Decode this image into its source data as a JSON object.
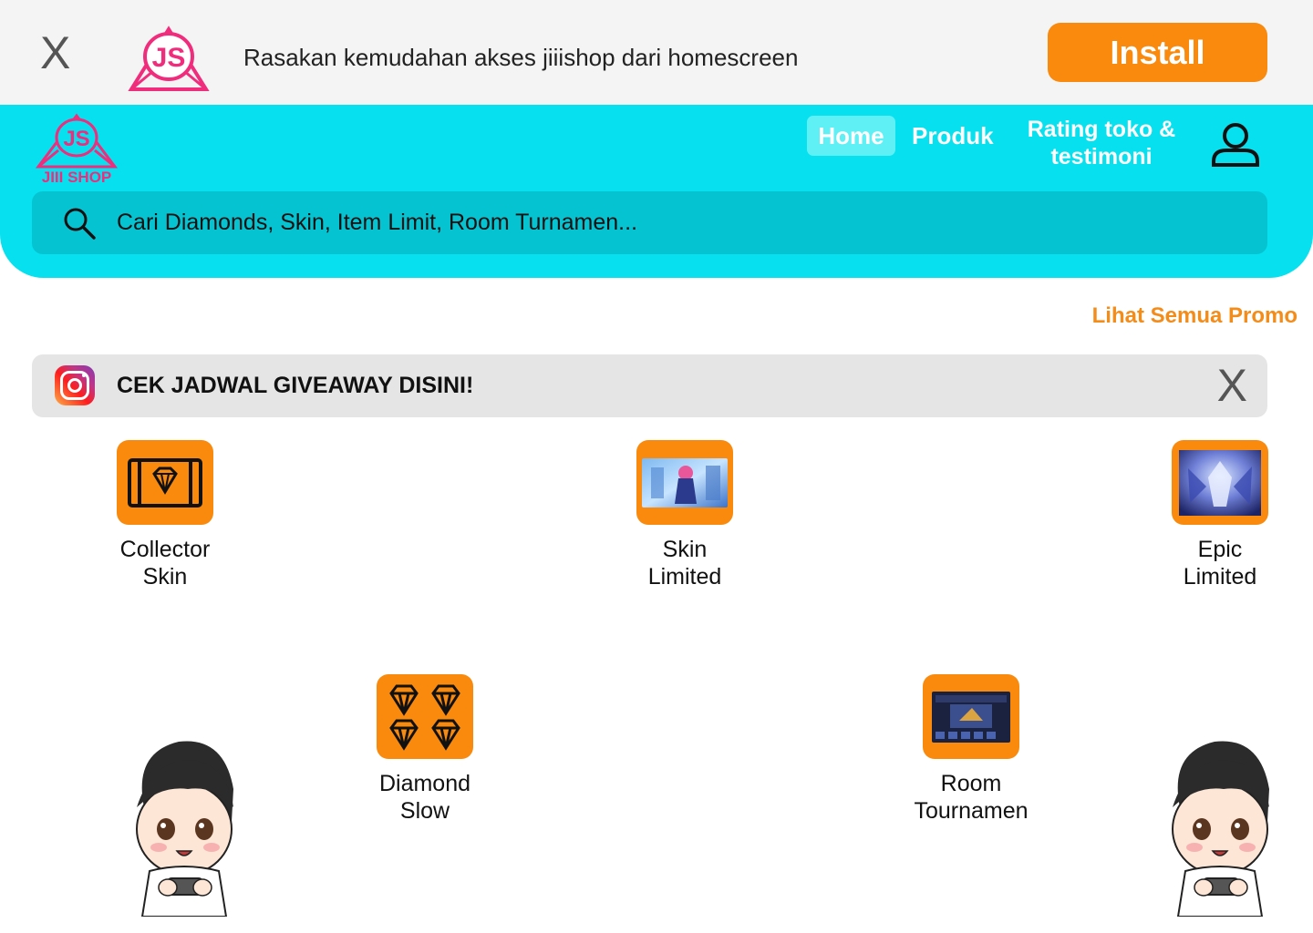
{
  "install_banner": {
    "close_label": "X",
    "message": "Rasakan kemudahan akses jiiishop dari homescreen",
    "install_label": "Install",
    "logo_text": "JS"
  },
  "header": {
    "logo_text": "JS",
    "brand_name": "JIII SHOP",
    "nav": {
      "home": "Home",
      "produk": "Produk",
      "rating": "Rating toko & testimoni"
    },
    "search_placeholder": "Cari Diamonds, Skin, Item Limit, Room Turnamen..."
  },
  "promo_link": "Lihat Semua Promo",
  "giveaway": {
    "text": "CEK JADWAL GIVEAWAY DISINI!",
    "close_label": "X"
  },
  "categories": [
    {
      "label": "Collector\nSkin",
      "icon": "diamond-card-icon"
    },
    {
      "label": "Skin\nLimited",
      "icon": "skin-thumbnail"
    },
    {
      "label": "Epic\nLimited",
      "icon": "epic-thumbnail"
    },
    {
      "label": "Diamond\nSlow",
      "icon": "four-diamonds-icon"
    },
    {
      "label": "Room\nTournamen",
      "icon": "tournament-thumbnail"
    }
  ],
  "colors": {
    "accent_orange": "#f98a0d",
    "header_cyan": "#07e0ee",
    "search_cyan": "#06c3d1",
    "logo_pink": "#f02d7d"
  }
}
